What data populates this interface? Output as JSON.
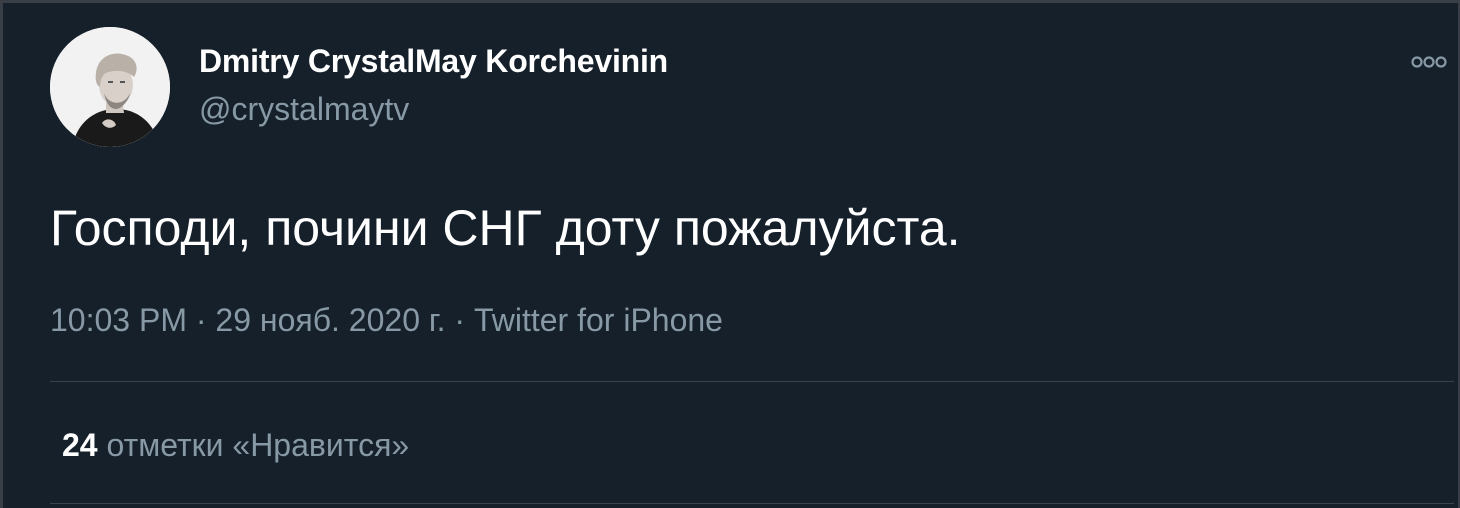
{
  "tweet": {
    "author_name": "Dmitry CrystalMay Korchevinin",
    "author_handle": "@crystalmaytv",
    "text": "Господи, почини СНГ доту пожалуйста.",
    "time": "10:03 PM",
    "separator": "·",
    "date": "29 нояб. 2020 г.",
    "source": "Twitter for iPhone",
    "likes_count": "24",
    "likes_label": "отметки «Нравится»"
  },
  "icons": {
    "more": "more-horizontal-icon",
    "avatar": "avatar-photo"
  },
  "colors": {
    "background": "#15202b",
    "primary_text": "#ffffff",
    "secondary_text": "#8899a6",
    "divider": "#38444d"
  }
}
